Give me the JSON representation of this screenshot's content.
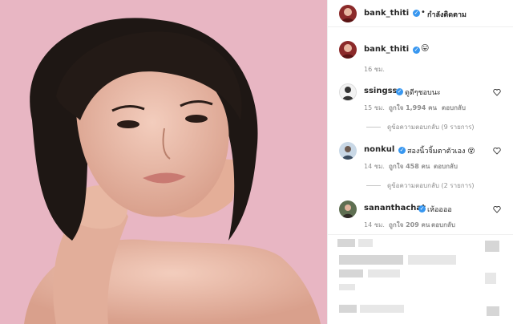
{
  "header": {
    "username": "bank_thiti",
    "dot": "•",
    "follow_label": "กำลังติดตาม"
  },
  "caption": {
    "username": "bank_thiti",
    "emoji": "😛",
    "time": "16 ชม."
  },
  "comments": [
    {
      "username": "ssingss",
      "text": "ดูดีๆชอบนะ",
      "time": "15 ชม.",
      "likes": "ถูกใจ 1,994 คน",
      "reply_label": "ตอบกลับ",
      "view_replies": "ดูข้อความตอบกลับ (9 รายการ)"
    },
    {
      "username": "nonkul",
      "text": "สองนิ้วจิ้มตาตัวเอง 😵",
      "time": "14 ชม.",
      "likes": "ถูกใจ 458 คน",
      "reply_label": "ตอบกลับ",
      "view_replies": "ดูข้อความตอบกลับ (2 รายการ)"
    },
    {
      "username": "sananthachat",
      "text": "เห้ออออ",
      "time": "14 ชม.",
      "likes": "ถูกใจ 209 คน",
      "reply_label": "ตอบกลับ"
    }
  ],
  "icons": [
    "verified-badge-icon",
    "heart-icon"
  ],
  "colors": {
    "verified": "#3897f0",
    "background_pink": "#e9b7c4",
    "meta_gray": "#8e8e8e"
  }
}
